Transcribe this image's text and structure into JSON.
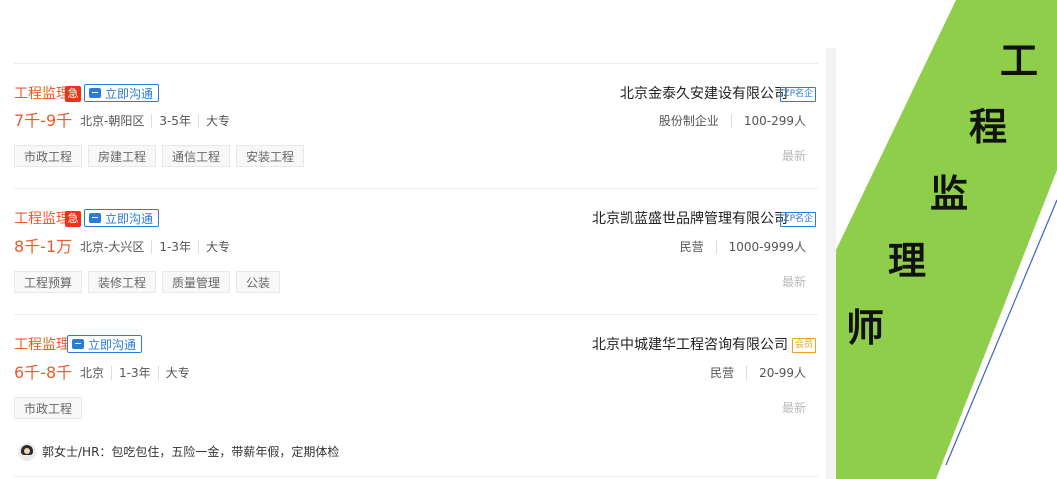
{
  "jobs": [
    {
      "title": "工程监理",
      "urgent": "急",
      "chat_label": "立即沟通",
      "company": "北京金泰久安建设有限公司",
      "company_badge": "ZP名企",
      "salary": "7千-9千",
      "location": "北京-朝阳区",
      "experience": "3-5年",
      "education": "大专",
      "company_type": "股份制企业",
      "company_size": "100-299人",
      "tags": [
        "市政工程",
        "房建工程",
        "通信工程",
        "安装工程"
      ],
      "status": "最新"
    },
    {
      "title": "工程监理",
      "urgent": "急",
      "chat_label": "立即沟通",
      "company": "北京凯蓝盛世品牌管理有限公司",
      "company_badge": "ZP名企",
      "salary": "8千-1万",
      "location": "北京-大兴区",
      "experience": "1-3年",
      "education": "大专",
      "company_type": "民营",
      "company_size": "1000-9999人",
      "tags": [
        "工程预算",
        "装修工程",
        "质量管理",
        "公装"
      ],
      "status": "最新"
    },
    {
      "title": "工程监理",
      "chat_label": "立即沟通",
      "company": "北京中城建华工程咨询有限公司",
      "company_badge": "会员",
      "salary": "6千-8千",
      "location": "北京",
      "experience": "1-3年",
      "education": "大专",
      "company_type": "民营",
      "company_size": "20-99人",
      "tags": [
        "市政工程"
      ],
      "status": "最新",
      "hr_text": "郭女士/HR：包吃包住，五险一金，带薪年假，定期体检"
    }
  ],
  "banner": {
    "chars": [
      "工",
      "程",
      "监",
      "理",
      "师"
    ],
    "accent_color": "#8fce4a",
    "line_color": "#3a63c8"
  }
}
